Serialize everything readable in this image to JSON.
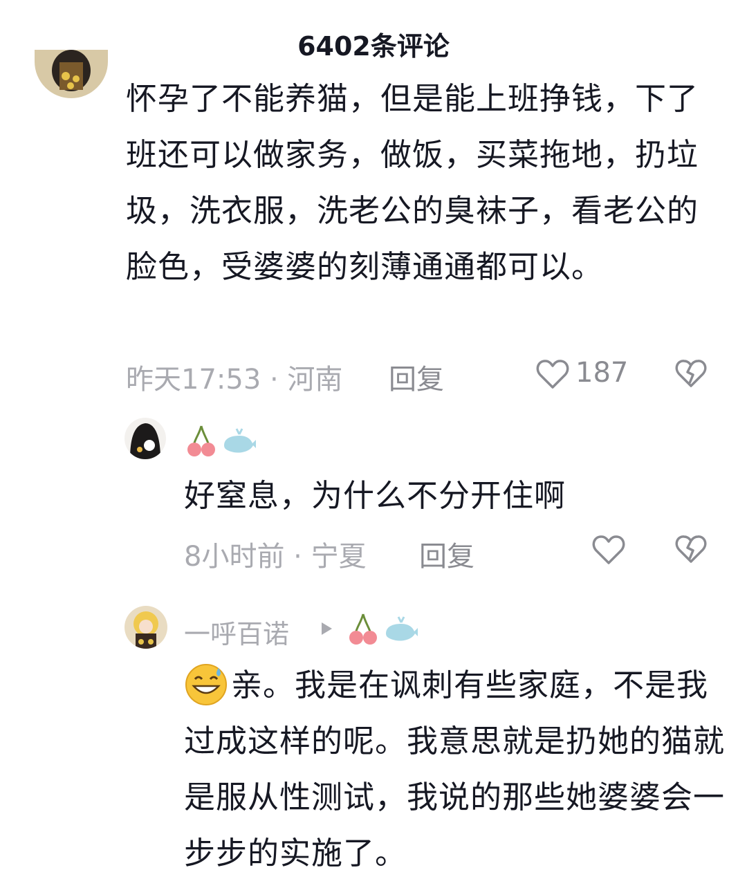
{
  "header": {
    "title": "6402条评论"
  },
  "comments": [
    {
      "text": "怀孕了不能养猫，但是能上班挣钱，下了班还可以做家务，做饭，买菜拖地，扔垃圾，洗衣服，洗老公的臭袜子，看老公的脸色，受婆婆的刻薄通通都可以。",
      "meta": "昨天17:53 · 河南",
      "reply_label": "回复",
      "likes": "187"
    }
  ],
  "replies": [
    {
      "text": "好窒息，为什么不分开住啊",
      "meta": "8小时前 · 宁夏",
      "reply_label": "回复"
    },
    {
      "username": "一呼百诺",
      "text": "亲。我是在讽刺有些家庭，不是我过成这样的呢。我意思就是扔她的猫就是服从性测试，我说的那些她婆婆会一步步的实施了。"
    }
  ],
  "icons": {
    "like": "heart-outline-icon",
    "dislike": "broken-heart-icon",
    "arrow": "play-arrow-icon",
    "emoji": "grinning-sweat-emoji",
    "badge1": "cherry-emoji",
    "badge2": "whale-emoji"
  },
  "colors": {
    "text": "#161823",
    "meta": "#a9aab0",
    "action": "#8a8b91"
  }
}
